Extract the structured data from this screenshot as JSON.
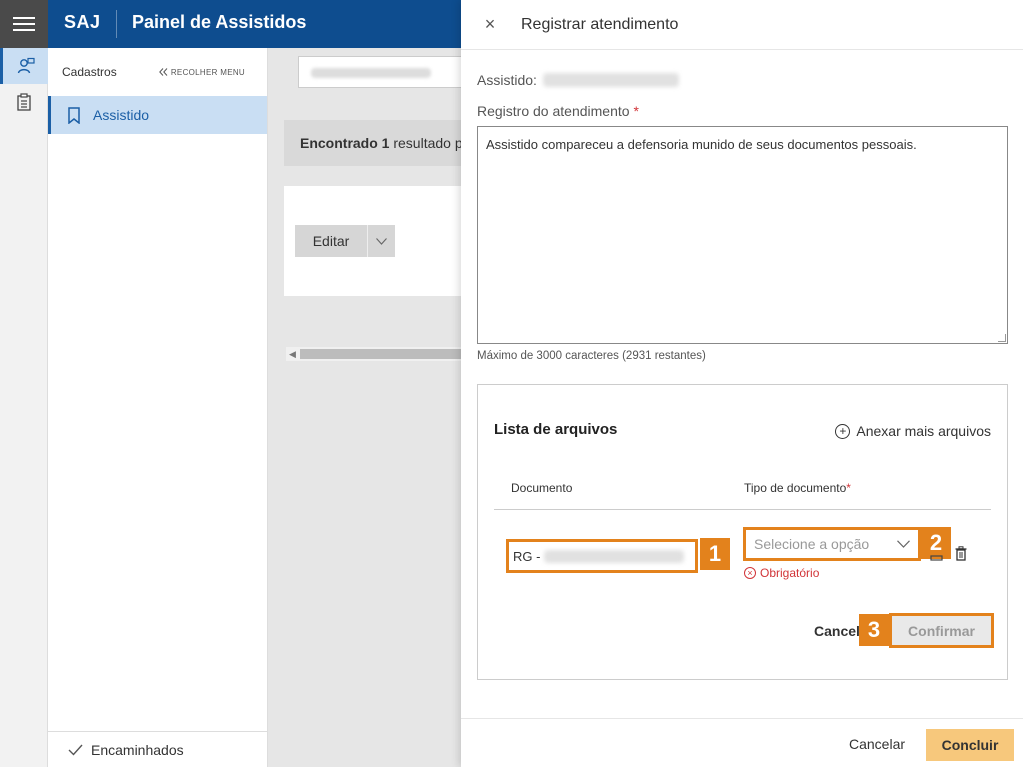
{
  "header": {
    "brand": "SAJ",
    "title": "Painel de Assistidos"
  },
  "sidenav": {
    "section_title": "Cadastros",
    "collapse_label": "RECOLHER MENU",
    "items": [
      {
        "label": "Assistido",
        "icon": "bookmark-icon",
        "active": true
      }
    ],
    "footer_label": "Encaminhados"
  },
  "main": {
    "result_count_prefix": "Encontrado",
    "result_count": "1",
    "result_count_suffix": "resultado p",
    "edit_label": "Editar"
  },
  "panel": {
    "title": "Registrar atendimento",
    "assistido_label": "Assistido:",
    "registro_label": "Registro do atendimento",
    "required_mark": "*",
    "registro_value": "Assistido compareceu a defensoria munido de seus documentos pessoais.",
    "char_count": "Máximo de 3000 caracteres (2931 restantes)",
    "files": {
      "title": "Lista de arquivos",
      "add_label": "Anexar mais arquivos",
      "col_documento": "Documento",
      "col_tipo": "Tipo de documento",
      "doc_prefix": "RG -",
      "tipo_placeholder": "Selecione a opção",
      "required_msg": "Obrigatório",
      "cancel_label": "Cancelar",
      "confirm_label": "Confirmar"
    },
    "footer": {
      "cancel_label": "Cancelar",
      "submit_label": "Concluir"
    }
  },
  "annotations": [
    "1",
    "2",
    "3"
  ],
  "colors": {
    "header_bg": "#0e4d8f",
    "accent_orange": "#e3821c",
    "submit_bg": "#f7c87c",
    "error": "#d13438",
    "active_nav": "#c9def3"
  }
}
